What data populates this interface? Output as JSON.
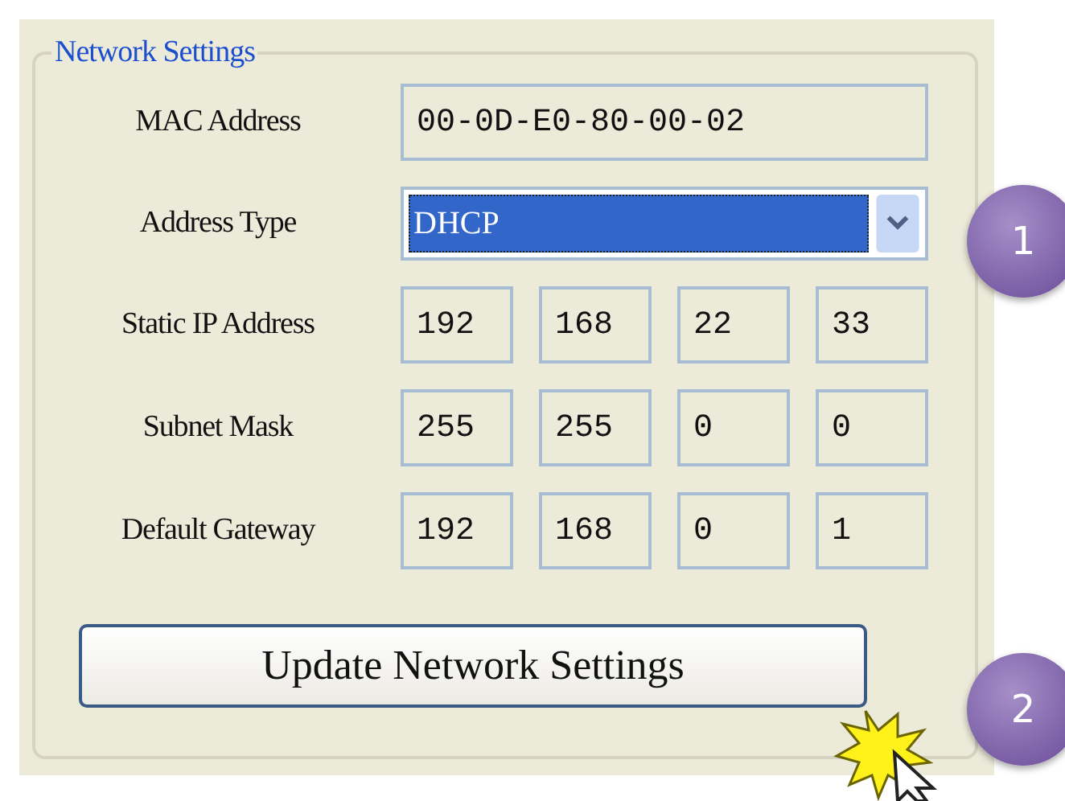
{
  "group": {
    "title": "Network Settings"
  },
  "mac": {
    "label": "MAC Address",
    "value": "00-0D-E0-80-00-02"
  },
  "address_type": {
    "label": "Address Type",
    "value": "DHCP"
  },
  "ip_rows": [
    {
      "label": "Static IP Address",
      "octets": [
        "192",
        "168",
        "22",
        "33"
      ]
    },
    {
      "label": "Subnet Mask",
      "octets": [
        "255",
        "255",
        "0",
        "0"
      ]
    },
    {
      "label": "Default Gateway",
      "octets": [
        "192",
        "168",
        "0",
        "1"
      ]
    }
  ],
  "button": {
    "label": "Update Network Settings"
  },
  "callouts": [
    "1",
    "2"
  ]
}
